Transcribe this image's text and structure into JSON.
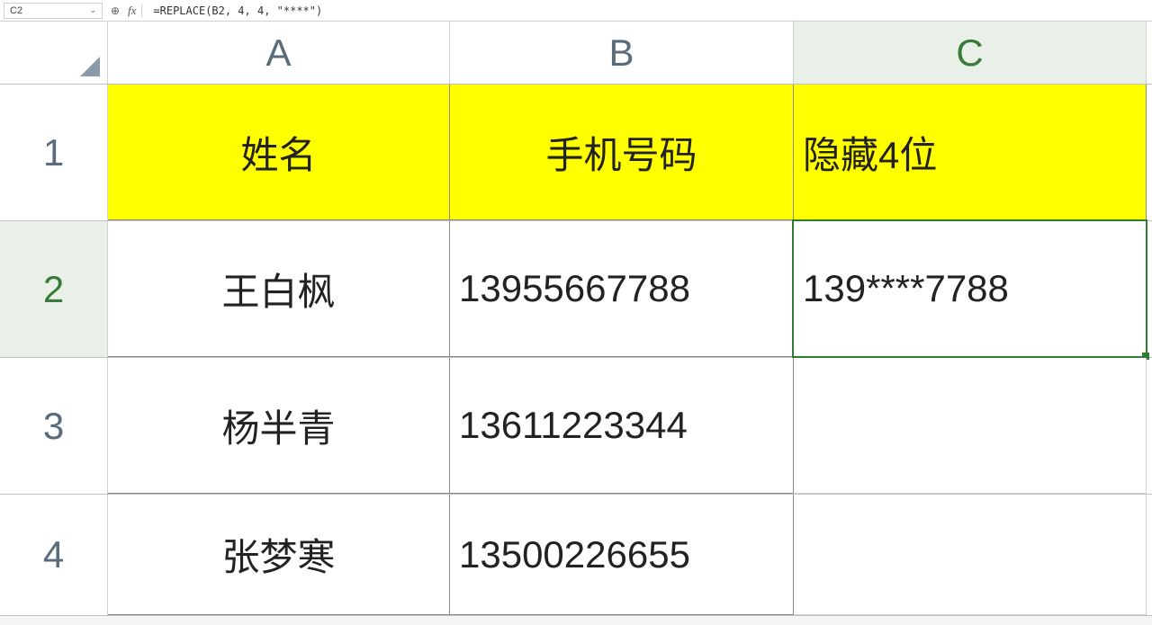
{
  "formula_bar": {
    "cell_ref": "C2",
    "fx_label": "fx",
    "formula": "=REPLACE(B2, 4, 4, \"****\")"
  },
  "columns": [
    "A",
    "B",
    "C"
  ],
  "rows": [
    "1",
    "2",
    "3",
    "4"
  ],
  "headers": {
    "a": "姓名",
    "b": "手机号码",
    "c": "隐藏4位"
  },
  "data": [
    {
      "name": "王白枫",
      "phone": "13955667788",
      "masked": "139****7788"
    },
    {
      "name": "杨半青",
      "phone": "13611223344",
      "masked": ""
    },
    {
      "name": "张梦寒",
      "phone": "13500226655",
      "masked": ""
    }
  ],
  "active_cell": "C2"
}
